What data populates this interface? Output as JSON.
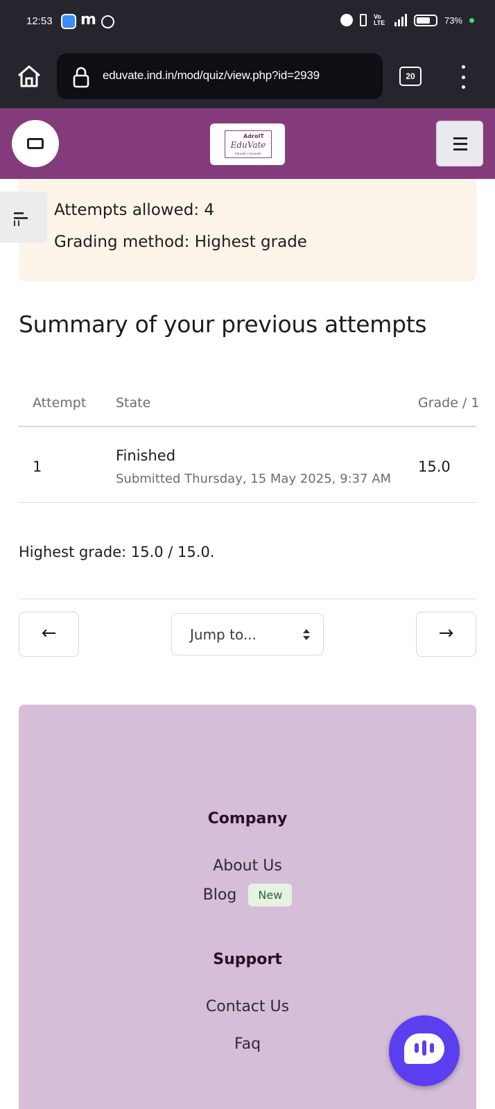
{
  "status_bar": {
    "time": "12:53",
    "battery": "73%",
    "network": "4G",
    "volte": "Vo LTE"
  },
  "browser": {
    "url": "eduvate.ind.in/mod/quiz/view.php?id=2939",
    "tab_count": "20"
  },
  "header": {
    "logo_top": "AdroIT",
    "logo_name": "EduVate",
    "logo_tagline": "Educate | Innovate"
  },
  "info": {
    "attempts_allowed": "Attempts allowed: 4",
    "grading_method": "Grading method: Highest grade"
  },
  "summary": {
    "title": "Summary of your previous attempts",
    "columns": [
      "Attempt",
      "State",
      "Grade / 1"
    ],
    "rows": [
      {
        "attempt": "1",
        "state": "Finished",
        "submitted": "Submitted Thursday, 15 May 2025, 9:37 AM",
        "grade": "15.0"
      }
    ],
    "highest_grade": "Highest grade: 15.0 / 15.0."
  },
  "navigation": {
    "prev": "←",
    "next": "→",
    "jump_label": "Jump to..."
  },
  "footer": {
    "company_heading": "Company",
    "about": "About Us",
    "blog": "Blog",
    "blog_badge": "New",
    "support_heading": "Support",
    "contact": "Contact Us",
    "faq": "Faq"
  },
  "colors": {
    "brand": "#843b7b",
    "footer_bg": "#d6bed8",
    "chat": "#5b3ef0",
    "info_bg": "#fcf4e9"
  }
}
